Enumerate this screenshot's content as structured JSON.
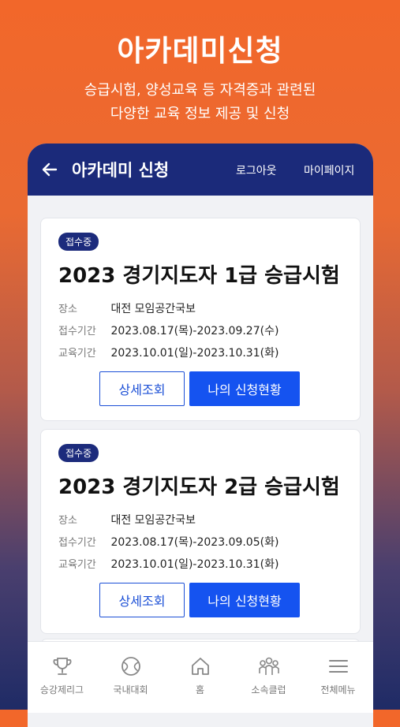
{
  "promo": {
    "title": "아카데미신청",
    "subtitle_line1": "승급시험, 양성교육 등 자격증과 관련된",
    "subtitle_line2": "다양한 교육 정보 제공 및 신청"
  },
  "appbar": {
    "back_icon": "arrow-left-icon",
    "title": "아카데미 신청",
    "logout": "로그아웃",
    "mypage": "마이페이지"
  },
  "cards": [
    {
      "badge": "접수중",
      "title": "2023 경기지도자 1급 승급시험",
      "place_label": "장소",
      "place": "대전 모임공간국보",
      "reg_label": "접수기간",
      "reg_period": "2023.08.17(목)-2023.09.27(수)",
      "edu_label": "교육기간",
      "edu_period": "2023.10.01(일)-2023.10.31(화)",
      "detail_btn": "상세조회",
      "status_btn": "나의 신청현황"
    },
    {
      "badge": "접수중",
      "title": "2023 경기지도자 2급 승급시험",
      "place_label": "장소",
      "place": "대전 모임공간국보",
      "reg_label": "접수기간",
      "reg_period": "2023.08.17(목)-2023.09.05(화)",
      "edu_label": "교육기간",
      "edu_period": "2023.10.01(일)-2023.10.31(화)",
      "detail_btn": "상세조회",
      "status_btn": "나의 신청현황"
    }
  ],
  "tabs": [
    {
      "label": "승강제리그",
      "icon": "trophy-icon"
    },
    {
      "label": "국내대회",
      "icon": "ball-icon"
    },
    {
      "label": "홈",
      "icon": "home-icon"
    },
    {
      "label": "소속클럽",
      "icon": "people-icon"
    },
    {
      "label": "전체메뉴",
      "icon": "menu-icon"
    }
  ],
  "colors": {
    "navy": "#1b2a7a",
    "primary": "#1553f0",
    "orange": "#f2672a"
  }
}
